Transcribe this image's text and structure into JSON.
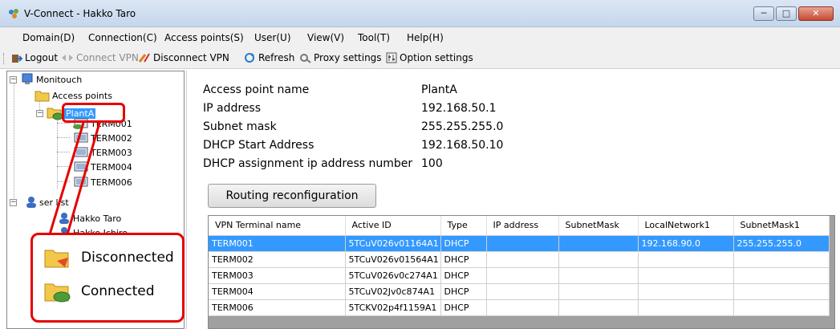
{
  "window": {
    "title": "V-Connect - Hakko Taro",
    "min": "─",
    "max": "□",
    "close": "✕"
  },
  "menu": [
    "Domain(D)",
    "Connection(C)",
    "Access points(S)",
    "User(U)",
    "View(V)",
    "Tool(T)",
    "Help(H)"
  ],
  "toolbar": {
    "logout": "Logout",
    "connect_vpn": "Connect VPN",
    "disconnect_vpn": "Disconnect VPN",
    "refresh": "Refresh",
    "proxy": "Proxy settings",
    "option": "Option settings"
  },
  "tree": {
    "root": "Monitouch",
    "access_points": "Access points",
    "plant": "PlantA",
    "terms": [
      "TERM001",
      "TERM002",
      "TERM003",
      "TERM004",
      "TERM006"
    ],
    "user_list": "ser list",
    "users": [
      "Hakko Taro",
      "Hakko Ichiro"
    ]
  },
  "details": {
    "rows": [
      {
        "key": "Access point name",
        "value": "PlantA"
      },
      {
        "key": "IP address",
        "value": "192.168.50.1"
      },
      {
        "key": "Subnet mask",
        "value": "255.255.255.0"
      },
      {
        "key": "DHCP Start Address",
        "value": "192.168.50.10"
      },
      {
        "key": "DHCP assignment ip address number",
        "value": "100"
      }
    ],
    "routing_button": "Routing reconfiguration"
  },
  "table": {
    "columns": [
      "VPN Terminal name",
      "Active ID",
      "Type",
      "IP address",
      "SubnetMask",
      "LocalNetwork1",
      "SubnetMask1"
    ],
    "rows": [
      [
        "TERM001",
        "5TCuV026v01164A1",
        "DHCP",
        "",
        "",
        "192.168.90.0",
        "255.255.255.0"
      ],
      [
        "TERM002",
        "5TCuV026v01564A1",
        "DHCP",
        "",
        "",
        "",
        ""
      ],
      [
        "TERM003",
        "5TCuV026v0c274A1",
        "DHCP",
        "",
        "",
        "",
        ""
      ],
      [
        "TERM004",
        "5TCuV02Jv0c874A1",
        "DHCP",
        "",
        "",
        "",
        ""
      ],
      [
        "TERM006",
        "5TCKV02p4f1159A1",
        "DHCP",
        "",
        "",
        "",
        ""
      ]
    ]
  },
  "legend": {
    "disconnected": "Disconnected",
    "connected": "Connected"
  },
  "colors": {
    "selection": "#3399ff",
    "annotation": "#e60000",
    "folder": "#f2c84b"
  }
}
